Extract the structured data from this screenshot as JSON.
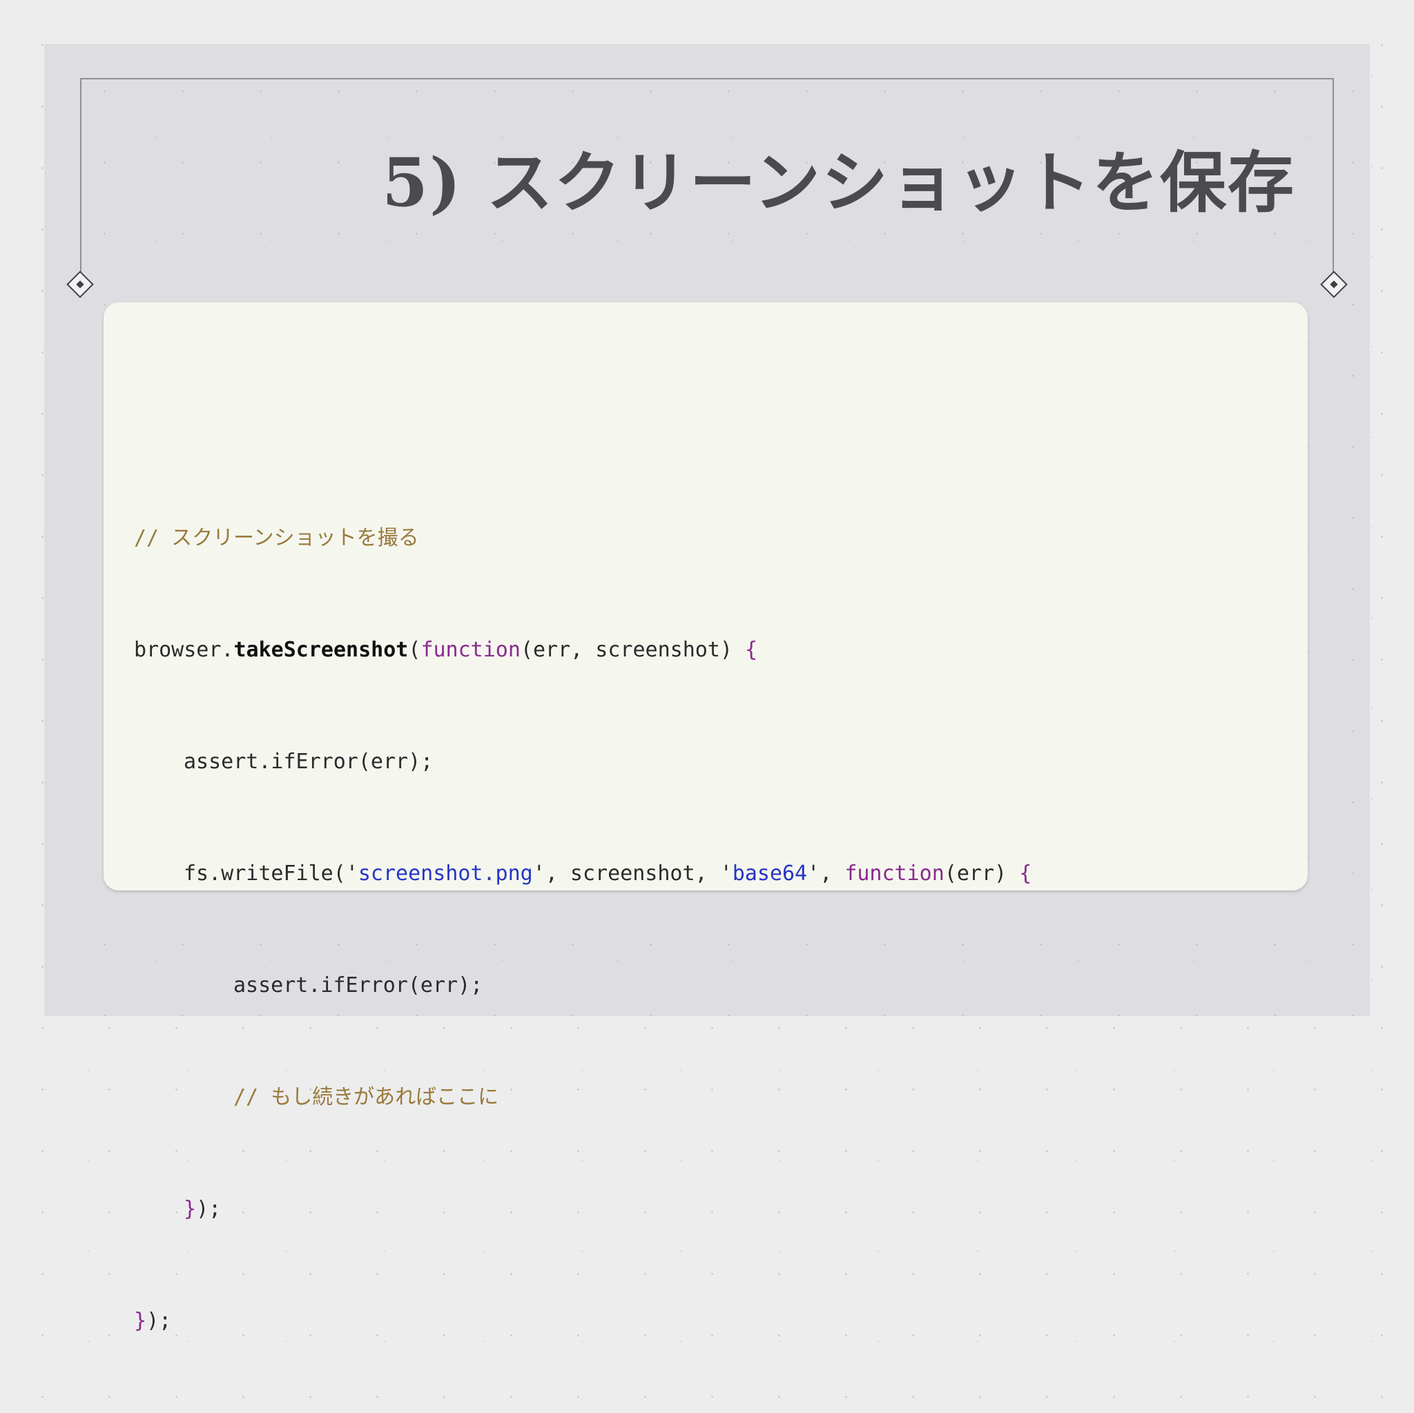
{
  "slide": {
    "title": "5) スクリーンショットを保存"
  },
  "code": {
    "line1": {
      "comment": "// スクリーンショットを撮る"
    },
    "line2": {
      "obj": "browser.",
      "method": "takeScreenshot",
      "paren_open": "(",
      "keyword": "function",
      "params": "(err, screenshot) ",
      "brace": "{"
    },
    "line3": {
      "text": "assert.ifError(err);"
    },
    "line4": {
      "call": "fs.writeFile(",
      "q1": "'",
      "string1": "screenshot.png",
      "q2": "'",
      "mid": ", screenshot, ",
      "q3": "'",
      "string2": "base64",
      "q4": "'",
      "sep": ", ",
      "keyword": "function",
      "params": "(err) ",
      "brace": "{"
    },
    "line5": {
      "text": "assert.ifError(err);"
    },
    "line6": {
      "comment": "// もし続きがあればここに"
    },
    "line7": {
      "brace": "}",
      "rest": ");"
    },
    "line8": {
      "brace": "}",
      "rest": ");"
    }
  },
  "colors": {
    "comment": "#9a7a3c",
    "keyword": "#8a2a8e",
    "string": "#2636c4",
    "code_background": "#f5f7ef",
    "slide_background": "#dedee2",
    "title": "#4a4a4f"
  }
}
